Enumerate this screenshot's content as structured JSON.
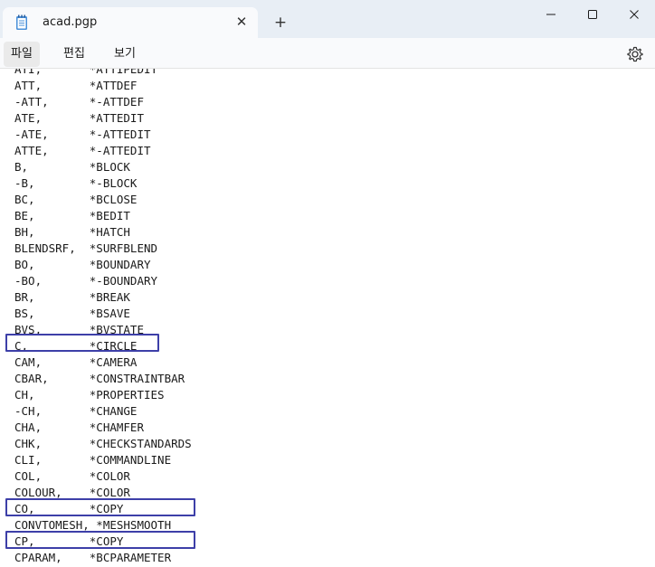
{
  "window": {
    "tab_title": "acad.pgp",
    "close_tab_symbol": "✕",
    "new_tab_symbol": "+"
  },
  "menu": {
    "items": [
      "파일",
      "편집",
      "보기"
    ]
  },
  "icons": {
    "app": "notepad-icon",
    "settings": "gear-icon"
  },
  "colors": {
    "highlight_box": "#3d3fa8",
    "titlebar": "#e8eef5"
  },
  "editor": {
    "lines": [
      "ATI,       *ATTIPEDIT",
      "ATT,       *ATTDEF",
      "-ATT,      *-ATTDEF",
      "ATE,       *ATTEDIT",
      "-ATE,      *-ATTEDIT",
      "ATTE,      *-ATTEDIT",
      "B,         *BLOCK",
      "-B,        *-BLOCK",
      "BC,        *BCLOSE",
      "BE,        *BEDIT",
      "BH,        *HATCH",
      "BLENDSRF,  *SURFBLEND",
      "BO,        *BOUNDARY",
      "-BO,       *-BOUNDARY",
      "BR,        *BREAK",
      "BS,        *BSAVE",
      "BVS,       *BVSTATE",
      "C,         *CIRCLE",
      "CAM,       *CAMERA",
      "CBAR,      *CONSTRAINTBAR",
      "CH,        *PROPERTIES",
      "-CH,       *CHANGE",
      "CHA,       *CHAMFER",
      "CHK,       *CHECKSTANDARDS",
      "CLI,       *COMMANDLINE",
      "COL,       *COLOR",
      "COLOUR,    *COLOR",
      "CO,        *COPY",
      "CONVTOMESH, *MESHSMOOTH",
      "CP,        *COPY",
      "CPARAM,    *BCPARAMETER"
    ]
  }
}
